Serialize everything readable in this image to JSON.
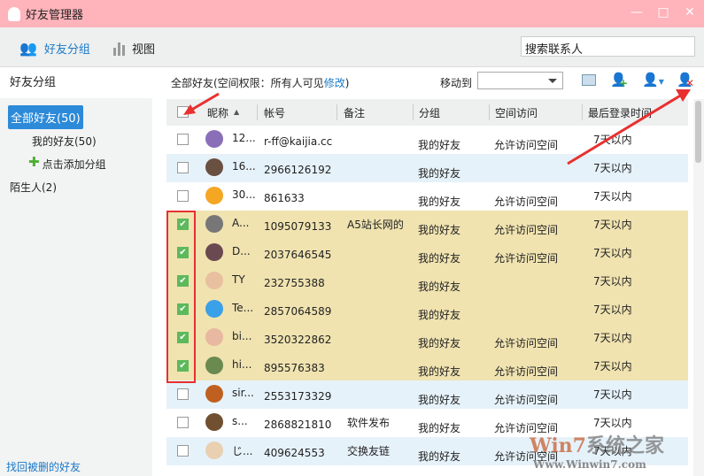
{
  "window": {
    "title": "好友管理器",
    "min": "—",
    "max": "□",
    "close": "✕"
  },
  "toolbar": {
    "tab_groups": "好友分组",
    "tab_view": "视图",
    "search_placeholder": "搜索联系人"
  },
  "sidebar": {
    "heading": "好友分组",
    "selected": "全部好友(50)",
    "my_friends": "我的好友(50)",
    "add_group": "点击添加分组",
    "strangers": "陌生人(2)",
    "recover": "找回被删的好友"
  },
  "main": {
    "title_prefix": "全部好友(空间权限：所有人可见",
    "edit": "修改",
    "title_suffix": ")",
    "move_to": "移动到",
    "move_value": ""
  },
  "columns": {
    "nick": "昵称",
    "sort": "▲",
    "account": "帐号",
    "remark": "备注",
    "group": "分组",
    "space": "空间访问",
    "last_login": "最后登录时间"
  },
  "rows": [
    {
      "nick": "12...",
      "account": "r-ff@kaijia.cc",
      "remark": "",
      "group": "我的好友",
      "space": "允许访问空间",
      "last": "7天以内",
      "checked": false,
      "bg": "w",
      "avatar": "#8a6fb8"
    },
    {
      "nick": "16...",
      "account": "2966126192",
      "remark": "",
      "group": "我的好友",
      "space": "",
      "last": "7天以内",
      "checked": false,
      "bg": "b",
      "avatar": "#6a5040"
    },
    {
      "nick": "30...",
      "account": "861633",
      "remark": "",
      "group": "我的好友",
      "space": "允许访问空间",
      "last": "7天以内",
      "checked": false,
      "bg": "w",
      "avatar": "#f5a623"
    },
    {
      "nick": "A...",
      "account": "1095079133",
      "remark": "A5站长网的",
      "group": "我的好友",
      "space": "允许访问空间",
      "last": "7天以内",
      "checked": true,
      "bg": "y",
      "avatar": "#777"
    },
    {
      "nick": "D...",
      "account": "2037646545",
      "remark": "",
      "group": "我的好友",
      "space": "允许访问空间",
      "last": "7天以内",
      "checked": true,
      "bg": "y",
      "avatar": "#6a4a50"
    },
    {
      "nick": "TY",
      "account": "232755388",
      "remark": "",
      "group": "我的好友",
      "space": "",
      "last": "7天以内",
      "checked": true,
      "bg": "y",
      "avatar": "#e8c0a0"
    },
    {
      "nick": "Te...",
      "account": "2857064589",
      "remark": "",
      "group": "我的好友",
      "space": "",
      "last": "7天以内",
      "checked": true,
      "bg": "y",
      "avatar": "#3aa0e8"
    },
    {
      "nick": "bi...",
      "account": "3520322862",
      "remark": "",
      "group": "我的好友",
      "space": "允许访问空间",
      "last": "7天以内",
      "checked": true,
      "bg": "y",
      "avatar": "#e8b8a0"
    },
    {
      "nick": "hi...",
      "account": "895576383",
      "remark": "",
      "group": "我的好友",
      "space": "允许访问空间",
      "last": "7天以内",
      "checked": true,
      "bg": "y",
      "avatar": "#6a8a50"
    },
    {
      "nick": "sir...",
      "account": "2553173329",
      "remark": "",
      "group": "我的好友",
      "space": "允许访问空间",
      "last": "7天以内",
      "checked": false,
      "bg": "b",
      "avatar": "#c06020"
    },
    {
      "nick": "s...",
      "account": "2868821810",
      "remark": "软件发布",
      "group": "我的好友",
      "space": "允许访问空间",
      "last": "7天以内",
      "checked": false,
      "bg": "w",
      "avatar": "#705030"
    },
    {
      "nick": "じ...",
      "account": "409624553",
      "remark": "交换友链",
      "group": "我的好友",
      "space": "允许访问空间",
      "last": "7天以内",
      "checked": false,
      "bg": "b",
      "avatar": "#e8d0b0"
    }
  ],
  "watermark": {
    "line1": "Win7系统之家",
    "line2": "Www.Winwin7.com"
  }
}
